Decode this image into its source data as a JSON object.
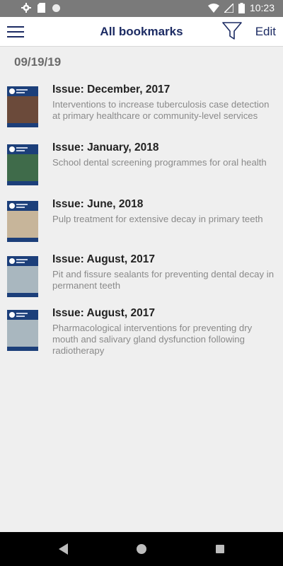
{
  "status_bar": {
    "time": "10:23",
    "icons": [
      "settings-icon",
      "sd-card-icon",
      "circle-icon",
      "wifi-icon",
      "no-sim-icon",
      "battery-icon"
    ]
  },
  "app_bar": {
    "title": "All bookmarks",
    "edit_label": "Edit",
    "icons": [
      "hamburger-menu-icon",
      "filter-icon"
    ]
  },
  "date_header": "09/19/19",
  "bookmarks": [
    {
      "issue": "Issue: December, 2017",
      "description": "Interventions to increase tuberculosis case detection at primary healthcare or community-level services",
      "thumb_color": "#6b4a3a"
    },
    {
      "issue": "Issue: January, 2018",
      "description": "School dental screening programmes for oral health",
      "thumb_color": "#3f6b4a"
    },
    {
      "issue": "Issue: June, 2018",
      "description": "Pulp treatment for extensive decay in primary teeth",
      "thumb_color": "#c7b59a"
    },
    {
      "issue": "Issue: August, 2017",
      "description": "Pit and fissure sealants for preventing dental decay in permanent teeth",
      "thumb_color": "#a9b7bf"
    },
    {
      "issue": "Issue: August, 2017",
      "description": "Pharmacological interventions for preventing dry mouth and salivary gland dysfunction following radiotherapy",
      "thumb_color": "#a9b7bf"
    }
  ],
  "colors": {
    "accent": "#1c2b63",
    "status_bar": "#7a7a7a",
    "background": "#efefef"
  },
  "nav_bar": {
    "icons": [
      "back-icon",
      "home-icon",
      "recents-icon"
    ]
  }
}
